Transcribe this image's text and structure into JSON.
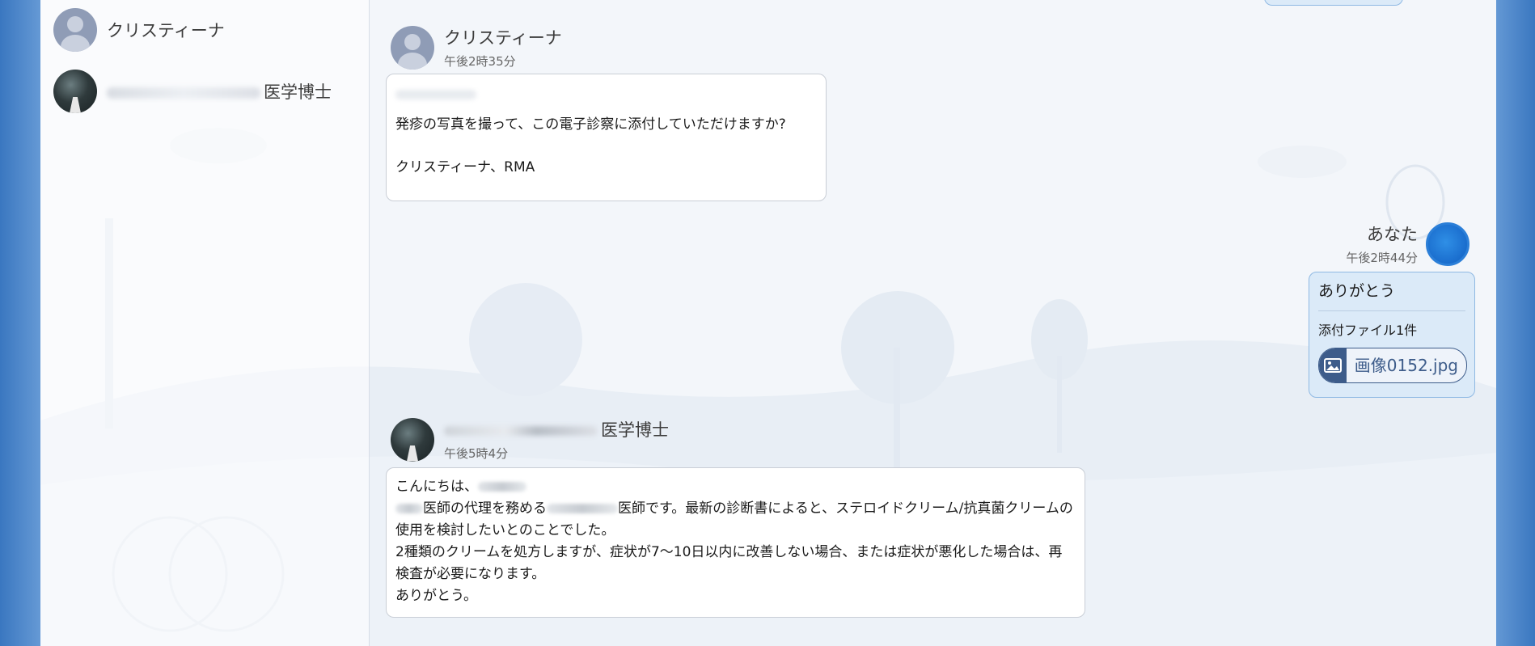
{
  "sidebar": {
    "contacts": [
      {
        "name": "クリスティーナ"
      },
      {
        "name": "医学博士"
      }
    ]
  },
  "messages": [
    {
      "sender": "クリスティーナ",
      "time": "午後2時35分",
      "body": [
        "発疹の写真を撮って、この電子診察に添付していただけますか?",
        "クリスティーナ、RMA"
      ]
    },
    {
      "sender": "あなた",
      "time": "午後2時44分",
      "title": "ありがとう",
      "attachment_label": "添付ファイル1件",
      "attachment_file": "画像0152.jpg"
    },
    {
      "sender": "医学博士",
      "time": "午後5時4分",
      "greeting": "こんにちは、",
      "line1a": "医師の代理を務める",
      "line1b": "医師です。最新の診断書によると、ステロイドクリーム/抗真菌クリームの使用を検討したいとのことでした。",
      "line2": "2種類のクリームを処方しますが、症状が7〜10日以内に改善しない場合、または症状が悪化した場合は、再検査が必要になります。",
      "line3": "ありがとう。"
    }
  ],
  "colors": {
    "accent": "#3d5c8a",
    "you_bubble": "#dbeaf8",
    "page_blue": "#3a77c0"
  },
  "icons": {
    "attachment": "image-icon"
  }
}
